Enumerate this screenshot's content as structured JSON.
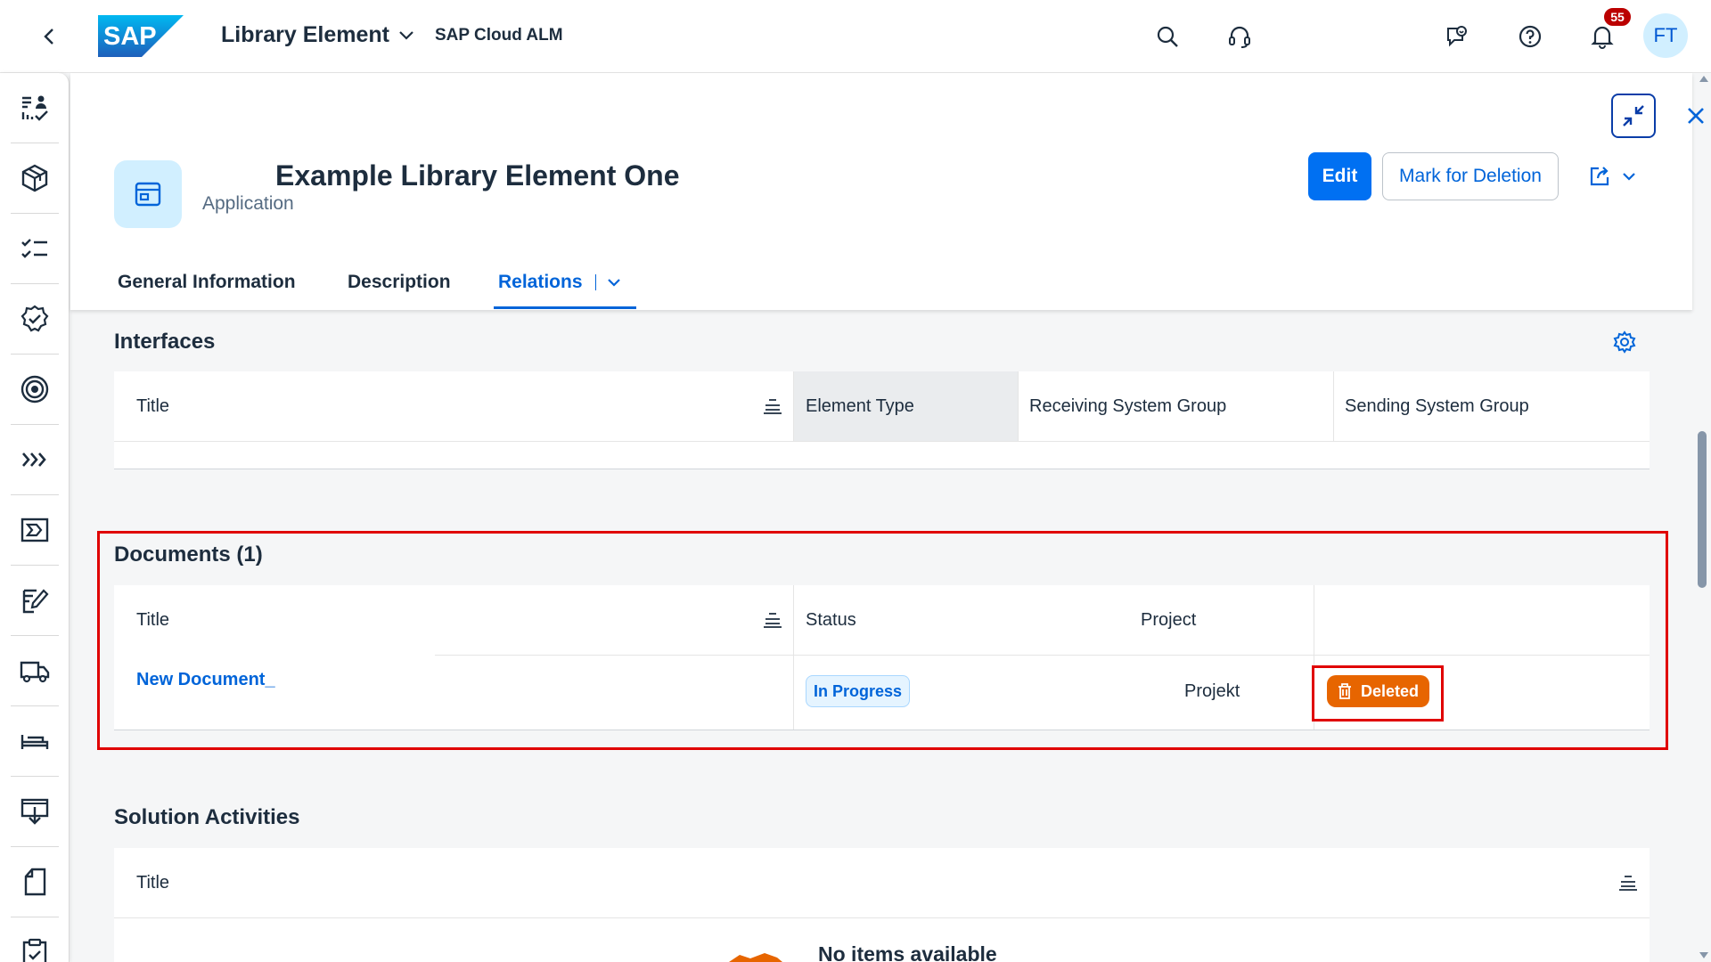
{
  "shell": {
    "app_title": "Library Element",
    "app_subtitle": "SAP Cloud ALM",
    "logo_text": "SAP",
    "notification_count": "55",
    "user_initials": "FT",
    "brand_color": "#0070f2"
  },
  "sidenav": {
    "items": [
      {
        "icon": "overview-tasks-icon"
      },
      {
        "icon": "package-icon"
      },
      {
        "icon": "checklist-icon"
      },
      {
        "icon": "quality-gate-icon"
      },
      {
        "icon": "target-icon"
      },
      {
        "icon": "process-flow-icon"
      },
      {
        "icon": "test-case-icon"
      },
      {
        "icon": "edit-document-icon"
      },
      {
        "icon": "delivery-truck-icon"
      },
      {
        "icon": "bed-icon"
      },
      {
        "icon": "deployment-icon"
      },
      {
        "icon": "document-icon"
      },
      {
        "icon": "clipboard-check-icon"
      }
    ]
  },
  "header": {
    "title": "Example Library Element One",
    "subtitle": "Application",
    "edit_label": "Edit",
    "mark_deletion_label": "Mark for Deletion",
    "tabs": [
      {
        "label": "General Information",
        "active": false
      },
      {
        "label": "Description",
        "active": false
      },
      {
        "label": "Relations",
        "active": true
      }
    ]
  },
  "interfaces": {
    "title": "Interfaces",
    "columns": [
      "Title",
      "Element Type",
      "Receiving System Group",
      "Sending System Group"
    ]
  },
  "documents": {
    "title": "Documents (1)",
    "columns": [
      "Title",
      "Status",
      "Project",
      ""
    ],
    "rows": [
      {
        "title": "New Document_",
        "status": "In Progress",
        "project": "Projekt",
        "deletion_badge": "Deleted"
      }
    ],
    "deleted_color": "#e76500",
    "highlight_color": "#e00000"
  },
  "solution_activities": {
    "title": "Solution Activities",
    "columns": [
      "Title"
    ],
    "empty_text": "No items available"
  }
}
